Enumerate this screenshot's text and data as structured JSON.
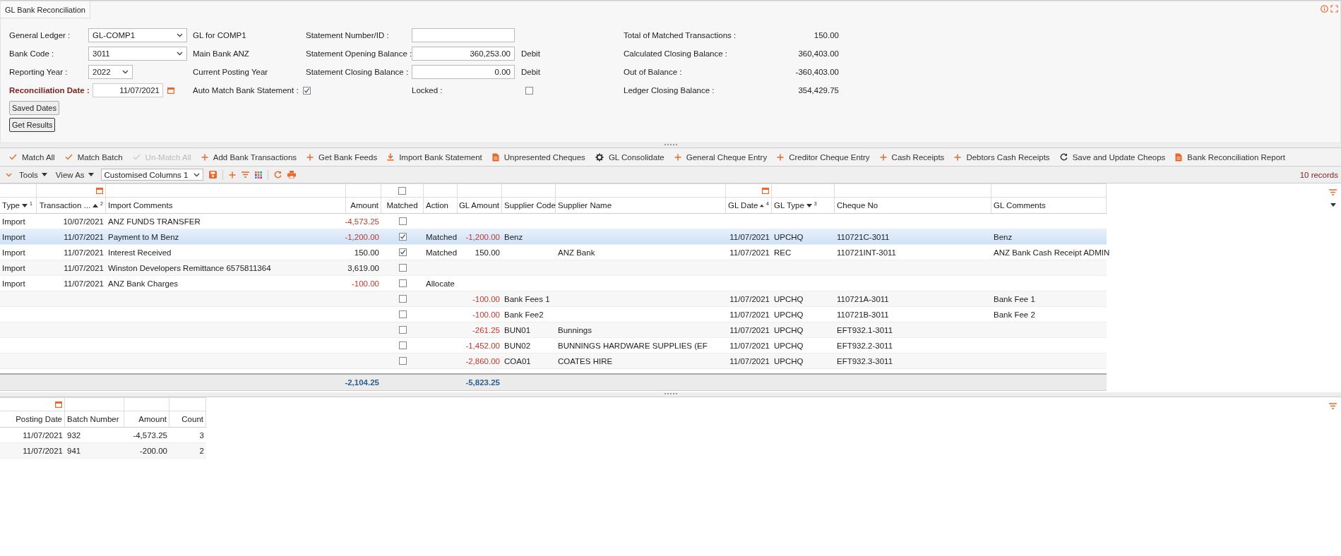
{
  "window": {
    "title": "GL Bank Reconciliation"
  },
  "form": {
    "left": [
      {
        "label": "General Ledger :",
        "kind": "select",
        "value": "GL-COMP1",
        "required": false,
        "note": "GL for COMP1"
      },
      {
        "label": "Bank Code :",
        "kind": "select",
        "value": "3011",
        "required": false,
        "note": "Main Bank ANZ"
      },
      {
        "label": "Reporting Year :",
        "kind": "year-select",
        "value": "2022",
        "required": false,
        "note": "Current Posting Year"
      },
      {
        "label": "Reconciliation Date :",
        "kind": "date",
        "value": "11/07/2021",
        "required": true,
        "option": {
          "label": "Auto Match Bank Statement :",
          "checked": true
        }
      }
    ],
    "statement": [
      {
        "label": "Statement Number/ID :",
        "kind": "input"
      },
      {
        "label": "Statement Opening Balance :",
        "kind": "input",
        "value": "360,253.00",
        "suffix": "Debit"
      },
      {
        "label": "Statement Closing Balance :",
        "kind": "input",
        "value": "0.00",
        "suffix": "Debit"
      },
      {
        "label": "Locked :",
        "kind": "checkbox",
        "checked": false
      }
    ],
    "totals": [
      {
        "label": "Total of Matched Transactions :",
        "value": "150.00"
      },
      {
        "label": "Calculated Closing Balance :",
        "value": "360,403.00"
      },
      {
        "label": "Out of Balance :",
        "value": "-360,403.00"
      },
      {
        "label": "Ledger Closing Balance :",
        "value": "354,429.75"
      }
    ],
    "buttons": [
      "Saved Dates",
      "Get Results"
    ]
  },
  "actions": [
    {
      "label": "Match All",
      "kind": "check",
      "disabled": false
    },
    {
      "label": "Match Batch",
      "kind": "check",
      "disabled": false
    },
    {
      "label": "Un-Match All",
      "kind": "check",
      "disabled": true
    },
    {
      "label": "Add Bank Transactions",
      "kind": "plus",
      "disabled": false
    },
    {
      "label": "Get Bank Feeds",
      "kind": "plus",
      "disabled": false
    },
    {
      "label": "Import Bank Statement",
      "kind": "download",
      "disabled": false
    },
    {
      "label": "Unpresented Cheques",
      "kind": "document",
      "disabled": false
    },
    {
      "label": "GL Consolidate",
      "kind": "gear",
      "disabled": false
    },
    {
      "label": "General Cheque Entry",
      "kind": "plus",
      "disabled": false
    },
    {
      "label": "Creditor Cheque Entry",
      "kind": "plus",
      "disabled": false
    },
    {
      "label": "Cash Receipts",
      "kind": "plus",
      "disabled": false
    },
    {
      "label": "Debtors Cash Receipts",
      "kind": "plus",
      "disabled": false
    },
    {
      "label": "Save and Update Cheops",
      "kind": "refresh",
      "disabled": false
    },
    {
      "label": "Bank Reconciliation Report",
      "kind": "document",
      "disabled": false
    }
  ],
  "grid_toolbar": {
    "tools": "Tools",
    "view_as": "View As",
    "layout": "Customised Columns 1",
    "record_count": "10 records"
  },
  "table": {
    "columns": [
      {
        "label": "Type",
        "kind": "plain",
        "sort_descending": true,
        "sort_order": "1"
      },
      {
        "label": "Transaction ...",
        "kind": "date-filter",
        "sort_descending": false,
        "sort_order": "2"
      },
      {
        "label": "Import Comments",
        "kind": "plain"
      },
      {
        "label": "Amount",
        "kind": "plain"
      },
      {
        "label": "Matched",
        "kind": "checkbox-filter",
        "filter_checked": false
      },
      {
        "label": "Action",
        "kind": "plain"
      },
      {
        "label": "GL Amount",
        "kind": "plain"
      },
      {
        "label": "Supplier Code",
        "kind": "plain"
      },
      {
        "label": "Supplier Name",
        "kind": "plain"
      },
      {
        "label": "GL Date",
        "kind": "date-filter",
        "sort_descending": false,
        "sort_order": "4"
      },
      {
        "label": "GL Type",
        "kind": "plain",
        "sort_descending": true,
        "sort_order": "3"
      },
      {
        "label": "Cheque No",
        "kind": "plain"
      },
      {
        "label": "GL Comments",
        "kind": "plain"
      }
    ],
    "rows": [
      {
        "type": "Import",
        "date": "10/07/2021",
        "comment": "ANZ FUNDS TRANSFER",
        "amount": "-4,573.25",
        "amount_negative": true,
        "matched": false,
        "selected": false
      },
      {
        "type": "Import",
        "date": "11/07/2021",
        "comment": "Payment to M Benz",
        "amount": "-1,200.00",
        "amount_negative": true,
        "matched": true,
        "selected": true,
        "action": "Matched",
        "gl_amount": "-1,200.00",
        "gl_amount_negative": true,
        "supplier_code": "Benz",
        "gl_date": "11/07/2021",
        "gl_type": "UPCHQ",
        "cheque_no": "110721C-3011",
        "gl_comments": "Benz"
      },
      {
        "type": "Import",
        "date": "11/07/2021",
        "comment": "Interest Received",
        "amount": "150.00",
        "amount_negative": false,
        "matched": true,
        "selected": false,
        "action": "Matched",
        "gl_amount": "150.00",
        "gl_amount_negative": false,
        "supplier_name": "ANZ Bank",
        "gl_date": "11/07/2021",
        "gl_type": "REC",
        "cheque_no": "110721INT-3011",
        "gl_comments": "ANZ Bank Cash Receipt ADMIN"
      },
      {
        "type": "Import",
        "date": "11/07/2021",
        "comment": "Winston Developers Remittance 6575811364",
        "amount": "3,619.00",
        "amount_negative": false,
        "matched": false,
        "selected": false
      },
      {
        "type": "Import",
        "date": "11/07/2021",
        "comment": "ANZ Bank Charges",
        "amount": "-100.00",
        "amount_negative": true,
        "matched": false,
        "selected": false,
        "action": "Allocate"
      },
      {
        "matched": false,
        "selected": false,
        "gl_amount": "-100.00",
        "gl_amount_negative": true,
        "supplier_code": "Bank Fees 1",
        "gl_date": "11/07/2021",
        "gl_type": "UPCHQ",
        "cheque_no": "110721A-3011",
        "gl_comments": "Bank Fee 1"
      },
      {
        "matched": false,
        "selected": false,
        "gl_amount": "-100.00",
        "gl_amount_negative": true,
        "supplier_code": "Bank Fee2",
        "gl_date": "11/07/2021",
        "gl_type": "UPCHQ",
        "cheque_no": "110721B-3011",
        "gl_comments": "Bank Fee 2"
      },
      {
        "matched": false,
        "selected": false,
        "gl_amount": "-261.25",
        "gl_amount_negative": true,
        "supplier_code": "BUN01",
        "supplier_name": "Bunnings",
        "gl_date": "11/07/2021",
        "gl_type": "UPCHQ",
        "cheque_no": "EFT932.1-3011"
      },
      {
        "matched": false,
        "selected": false,
        "gl_amount": "-1,452.00",
        "gl_amount_negative": true,
        "supplier_code": "BUN02",
        "supplier_name": "BUNNINGS HARDWARE SUPPLIES (EF",
        "gl_date": "11/07/2021",
        "gl_type": "UPCHQ",
        "cheque_no": "EFT932.2-3011"
      },
      {
        "matched": false,
        "selected": false,
        "gl_amount": "-2,860.00",
        "gl_amount_negative": true,
        "supplier_code": "COA01",
        "supplier_name": "COATES HIRE",
        "gl_date": "11/07/2021",
        "gl_type": "UPCHQ",
        "cheque_no": "EFT932.3-3011"
      }
    ],
    "totals": {
      "amount": "-2,104.25",
      "gl_amount": "-5,823.25"
    }
  },
  "batches": {
    "columns": [
      {
        "label": "Posting Date",
        "kind": "date-filter"
      },
      {
        "label": "Batch Number",
        "kind": "plain"
      },
      {
        "label": "Amount",
        "kind": "plain"
      },
      {
        "label": "Count",
        "kind": "plain"
      }
    ],
    "rows": [
      {
        "posting_date": "11/07/2021",
        "batch_number": "932",
        "amount": "-4,573.25",
        "count": "3"
      },
      {
        "posting_date": "11/07/2021",
        "batch_number": "941",
        "amount": "-200.00",
        "count": "2"
      }
    ]
  }
}
